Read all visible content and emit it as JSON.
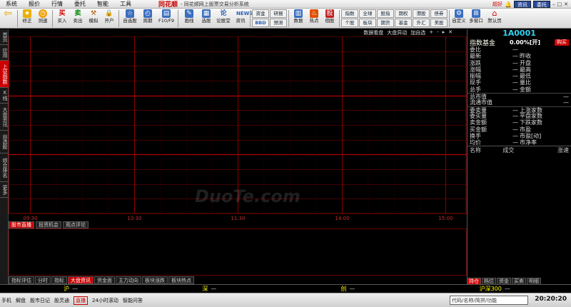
{
  "menubar": {
    "items": [
      "系统",
      "报价",
      "行情",
      "委托",
      "智能",
      "工具"
    ],
    "brand": "同花顺",
    "system_title": "- 同花顺网上股票交易分析系统",
    "right": [
      "资讯",
      "委托"
    ],
    "right_links": [
      "超好"
    ]
  },
  "toolbar": {
    "buttons": [
      {
        "label": "",
        "icon": "back-arrow-icon"
      },
      {
        "label": "修正",
        "icon": "star-icon"
      },
      {
        "label": "测速",
        "icon": "clock-icon"
      },
      {
        "label": "买入",
        "icon": "buy-icon"
      },
      {
        "label": "卖出",
        "icon": "sell-icon"
      },
      {
        "label": "模拟",
        "icon": "gavel-icon"
      },
      {
        "label": "开户",
        "icon": "lock-icon"
      },
      {
        "label": "自选股",
        "icon": "star-box-icon"
      },
      {
        "label": "周期",
        "icon": "cycle-icon"
      },
      {
        "label": "F10/F9",
        "icon": "f10-icon"
      },
      {
        "label": "画线",
        "icon": "draw-line-icon"
      },
      {
        "label": "选股",
        "icon": "filter-icon"
      },
      {
        "label": "论股堂",
        "icon": "forum-icon"
      },
      {
        "label": "资讯",
        "icon": "news-icon"
      }
    ],
    "grid1": [
      "资金",
      "研报",
      "BBD",
      "预测"
    ],
    "grid2": [
      "数据",
      "热点",
      "個股"
    ],
    "grid3": [
      "指数",
      "全球",
      "股指",
      "期权",
      "港股",
      "债券",
      "个股",
      "板块",
      "期货",
      "基金",
      "外汇",
      "美股"
    ],
    "right_buttons": [
      "自定义",
      "多窗口",
      "默认页"
    ]
  },
  "sidetabs": [
    {
      "label": "首页",
      "active": false
    },
    {
      "label": "应用",
      "active": false
    },
    {
      "label": "上证指数",
      "active": true
    },
    {
      "label": "K线图",
      "active": false
    },
    {
      "label": "大盘资讯",
      "active": false
    },
    {
      "label": "自选股",
      "active": false
    },
    {
      "label": "综合排名",
      "active": false
    },
    {
      "label": "更多",
      "active": false
    }
  ],
  "chart_header": [
    "数据看盘",
    "大盘异动",
    "加自选",
    "+",
    "-"
  ],
  "chart_data": {
    "type": "line",
    "title": "",
    "x_ticks": [
      "09:30",
      "10:30",
      "11:30",
      "14:00",
      "15:00"
    ],
    "series": [],
    "grid": true
  },
  "panel_tabs": [
    {
      "label": "股市直播",
      "active": true
    },
    {
      "label": "投资机会",
      "active": false
    },
    {
      "label": "观点评论",
      "active": false
    }
  ],
  "bottom_tabs": [
    {
      "label": "指标评估",
      "active": false
    },
    {
      "label": "分时",
      "active": false
    },
    {
      "label": "指标",
      "active": false
    },
    {
      "label": "大盘资讯",
      "active": true
    },
    {
      "label": "资金面",
      "active": false
    },
    {
      "label": "主力动向",
      "active": false
    },
    {
      "label": "板块涨跌",
      "active": false
    },
    {
      "label": "板块热点",
      "active": false
    }
  ],
  "quote": {
    "code": "1A0001",
    "name": "指数基金",
    "pct": "0.00%[开]",
    "buy_button": "购买",
    "rows": [
      {
        "a": "委比",
        "b": "—",
        "c": "",
        "d": ""
      },
      {
        "a": "最新",
        "b": "—",
        "c": "昨收",
        "d": ""
      },
      {
        "a": "涨跌",
        "b": "—",
        "c": "开盘",
        "d": ""
      },
      {
        "a": "涨幅",
        "b": "—",
        "c": "最高",
        "d": ""
      },
      {
        "a": "振幅",
        "b": "—",
        "c": "最低",
        "d": ""
      },
      {
        "a": "现手",
        "b": "—",
        "c": "量比",
        "d": ""
      },
      {
        "a": "总手",
        "b": "—",
        "c": "金额",
        "d": ""
      },
      {
        "a": "总市值",
        "b": "",
        "c": "",
        "d": "—"
      },
      {
        "a": "流通市值",
        "b": "",
        "c": "",
        "d": "—"
      },
      {
        "a": "委卖量",
        "b": "—",
        "c": "上涨家数",
        "d": ""
      },
      {
        "a": "委买量",
        "b": "—",
        "c": "平盘家数",
        "d": ""
      },
      {
        "a": "卖金额",
        "b": "—",
        "c": "下跌家数",
        "d": ""
      },
      {
        "a": "买金额",
        "b": "—",
        "c": "市盈",
        "d": ""
      },
      {
        "a": "换手",
        "b": "—",
        "c": "市盈[动]",
        "d": ""
      },
      {
        "a": "均价",
        "b": "—",
        "c": "市净率",
        "d": ""
      }
    ],
    "list_headers": [
      "名称",
      "成交",
      "涨速"
    ]
  },
  "right_bottom_tabs": [
    "持仓",
    "档位",
    "资金",
    "买卖",
    "明细"
  ],
  "watermark": "DuoTe.com",
  "status1": {
    "segments": [
      {
        "label": "沪",
        "value": "—"
      },
      {
        "label": "深",
        "value": "—"
      },
      {
        "label": "创",
        "value": "—"
      },
      {
        "label": "沪深300",
        "value": "—"
      }
    ]
  },
  "status2": {
    "items": [
      "手机",
      "解盘",
      "股市日记",
      "股灵通"
    ],
    "live": "直播",
    "live2": "24小时滚动",
    "smart": "智能问答",
    "search_placeholder": "代码/名称/简拼/功能",
    "clock": "20:20:20"
  }
}
